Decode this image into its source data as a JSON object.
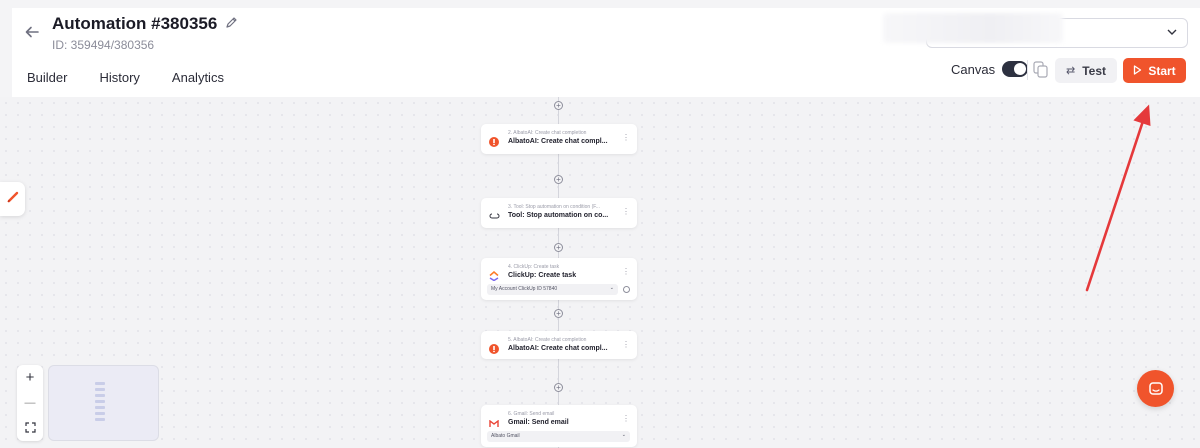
{
  "header": {
    "title": "Automation #380356",
    "id_text": "ID: 359494/380356",
    "account_select": {
      "value": ""
    }
  },
  "tabs": [
    {
      "label": "Builder"
    },
    {
      "label": "History"
    },
    {
      "label": "Analytics"
    }
  ],
  "toolbar": {
    "canvas_label": "Canvas",
    "canvas_enabled": true,
    "test_label": "Test",
    "start_label": "Start"
  },
  "nodes": [
    {
      "step": "2. AlbatoAI: Create chat completion",
      "name": "AlbatoAI: Create chat compl...",
      "icon": "albato-ai-icon"
    },
    {
      "step": "3. Tool: Stop automation on condition (F...",
      "name": "Tool: Stop automation on co...",
      "icon": "tool-icon"
    },
    {
      "step": "4. ClickUp: Create task",
      "name": "ClickUp: Create task",
      "icon": "clickup-icon",
      "account": "My Account ClickUp ID 57840"
    },
    {
      "step": "5. AlbatoAI: Create chat completion",
      "name": "AlbatoAI: Create chat compl...",
      "icon": "albato-ai-icon"
    },
    {
      "step": "6. Gmail: Send email",
      "name": "Gmail: Send email",
      "icon": "gmail-icon",
      "account": "Albato Gmail"
    }
  ],
  "zoom": {
    "in": "+",
    "out": "—",
    "fit": "⛶"
  },
  "colors": {
    "accent": "#f0542c",
    "annotation_arrow": "#e5393b",
    "toggle": "#2d3140"
  }
}
